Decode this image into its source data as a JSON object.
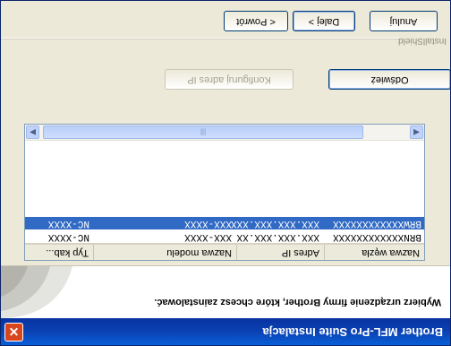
{
  "window": {
    "title": "Brother MFL-Pro Suite Instalacja",
    "close_icon": "close-icon"
  },
  "header": {
    "instruction": "Wybierz urządzenie firmy Brother, które chcesz zainstalować."
  },
  "devices": {
    "columns": [
      "Nazwa węzła",
      "Adres IP",
      "Nazwa modelu",
      "Typ kab..."
    ],
    "rows": [
      {
        "node": "BRNXXXXXXXXXXXX",
        "ip": "XXX.XXX.XXX.XX",
        "model": "XXX-XXXX",
        "type": "NC-XXXX",
        "selected": false
      },
      {
        "node": "BRWXXXXXXXXXXXX",
        "ip": "XXX.XXX.XXX.XXX",
        "model": "XXX-XXXX",
        "type": "NC-XXXX",
        "selected": true
      }
    ],
    "scroll_left_icon": "arrow-left-icon",
    "scroll_right_icon": "arrow-right-icon",
    "scroll_grip": "|||"
  },
  "actions": {
    "refresh": "Odśwież",
    "configure_ip": "Konfiguruj adres IP"
  },
  "footer": {
    "brand": "InstallShield",
    "back": "< Powrót",
    "next": "Dalej >",
    "cancel": "Anuluj"
  },
  "colors": {
    "titlebar": "#0a4cc4",
    "selection": "#316ac5",
    "close_button": "#d8441c"
  }
}
